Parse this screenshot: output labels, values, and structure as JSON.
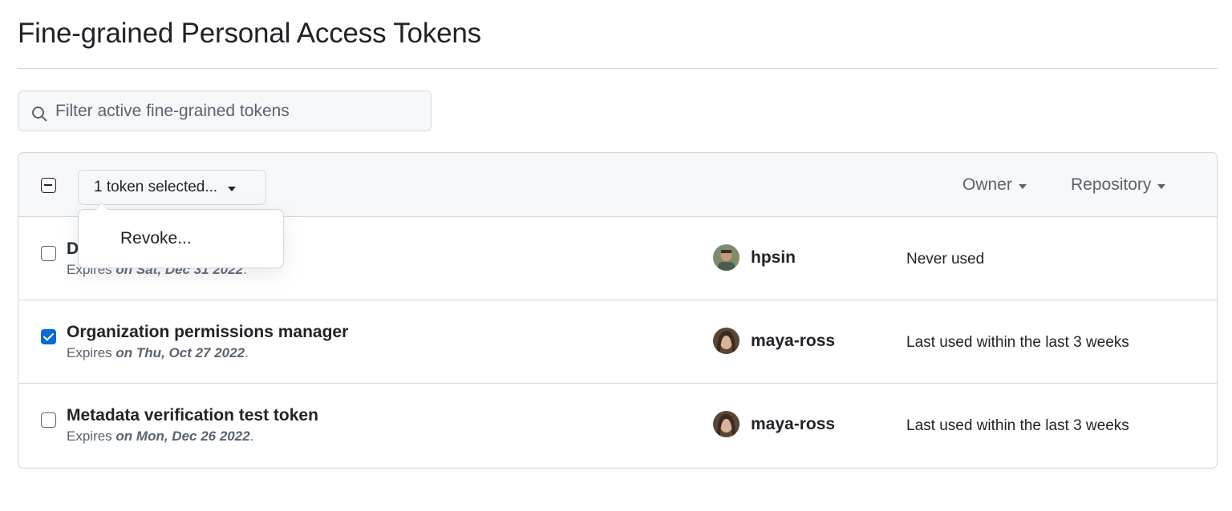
{
  "page": {
    "title": "Fine-grained Personal Access Tokens"
  },
  "filter": {
    "placeholder": "Filter active fine-grained tokens",
    "icon": "search-icon"
  },
  "table_header": {
    "selected_label": "1 token selected...",
    "owner_label": "Owner",
    "repository_label": "Repository"
  },
  "dropdown_menu": {
    "items": [
      {
        "label": "Revoke..."
      }
    ]
  },
  "tokens": [
    {
      "name": "D",
      "expires_prefix": "Expires ",
      "expires_date": "on Sat, Dec 31 2022",
      "expires_suffix": ".",
      "owner": "hpsin",
      "usage": "Never used",
      "checked": false
    },
    {
      "name": "Organization permissions manager",
      "expires_prefix": "Expires ",
      "expires_date": "on Thu, Oct 27 2022",
      "expires_suffix": ".",
      "owner": "maya-ross",
      "usage": "Last used within the last 3 weeks",
      "checked": true
    },
    {
      "name": "Metadata verification test token",
      "expires_prefix": "Expires ",
      "expires_date": "on Mon, Dec 26 2022",
      "expires_suffix": ".",
      "owner": "maya-ross",
      "usage": "Last used within the last 3 weeks",
      "checked": false
    }
  ],
  "colors": {
    "accent": "#0969da",
    "border": "#d0d7de",
    "header_bg": "#f6f8fa",
    "muted_text": "#59636e"
  }
}
